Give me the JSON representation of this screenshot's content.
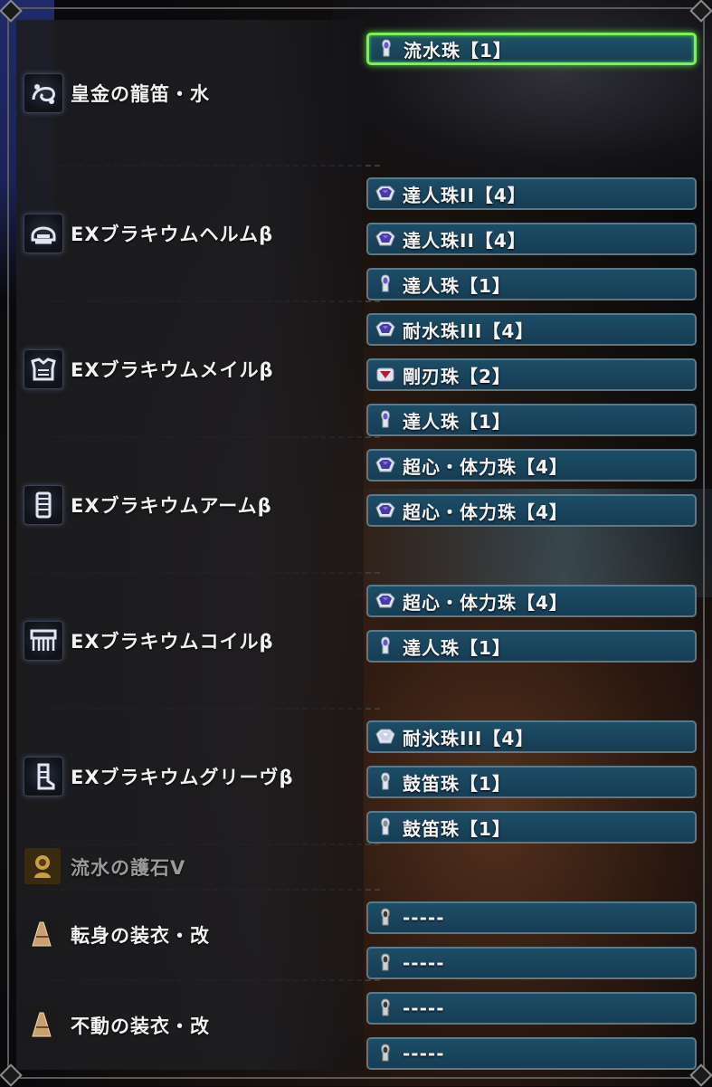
{
  "equipment": [
    {
      "name": "皇金の龍笛・水",
      "icon": "hunting-horn-icon",
      "decorations": [
        {
          "label": "流水珠【1】",
          "gem": "gem-lv1-icon",
          "selected": true
        }
      ]
    },
    {
      "name": "EXブラキウムヘルムβ",
      "icon": "helm-icon",
      "decorations": [
        {
          "label": "達人珠II【4】",
          "gem": "gem-lv4-icon"
        },
        {
          "label": "達人珠II【4】",
          "gem": "gem-lv4-icon"
        },
        {
          "label": "達人珠【1】",
          "gem": "gem-lv1-icon"
        }
      ]
    },
    {
      "name": "EXブラキウムメイルβ",
      "icon": "chest-armor-icon",
      "decorations": [
        {
          "label": "耐水珠III【4】",
          "gem": "gem-lv4-icon"
        },
        {
          "label": "剛刃珠【2】",
          "gem": "gem-lv2-icon"
        },
        {
          "label": "達人珠【1】",
          "gem": "gem-lv1-icon"
        }
      ]
    },
    {
      "name": "EXブラキウムアームβ",
      "icon": "arm-armor-icon",
      "decorations": [
        {
          "label": "超心・体力珠【4】",
          "gem": "gem-lv4-icon"
        },
        {
          "label": "超心・体力珠【4】",
          "gem": "gem-lv4-icon"
        }
      ]
    },
    {
      "name": "EXブラキウムコイルβ",
      "icon": "waist-armor-icon",
      "decorations": [
        {
          "label": "超心・体力珠【4】",
          "gem": "gem-lv4-icon"
        },
        {
          "label": "達人珠【1】",
          "gem": "gem-lv1-icon"
        }
      ]
    },
    {
      "name": "EXブラキウムグリーヴβ",
      "icon": "leg-armor-icon",
      "decorations": [
        {
          "label": "耐氷珠III【4】",
          "gem": "gem-lv4-white-icon"
        },
        {
          "label": "鼓笛珠【1】",
          "gem": "gem-lv1-gray-icon"
        },
        {
          "label": "鼓笛珠【1】",
          "gem": "gem-lv1-gray-icon"
        }
      ]
    },
    {
      "name": "流水の護石V",
      "icon": "charm-icon",
      "dim": true,
      "decorations": []
    },
    {
      "name": "転身の装衣・改",
      "icon": "mantle-icon",
      "decorations": [
        {
          "label": "-----",
          "gem": "empty-slot-icon"
        },
        {
          "label": "-----",
          "gem": "empty-slot-icon"
        }
      ]
    },
    {
      "name": "不動の装衣・改",
      "icon": "mantle-icon",
      "decorations": [
        {
          "label": "-----",
          "gem": "empty-slot-icon"
        },
        {
          "label": "-----",
          "gem": "empty-slot-icon"
        }
      ]
    }
  ],
  "colors": {
    "slot_bg": "#1a4660",
    "slot_border": "#5d7887",
    "selected_border": "#7cf05a",
    "gem_lv4": "#4a3aa8",
    "gem_lv2": "#b0203a",
    "gem_lv1": "#6a58c8"
  }
}
